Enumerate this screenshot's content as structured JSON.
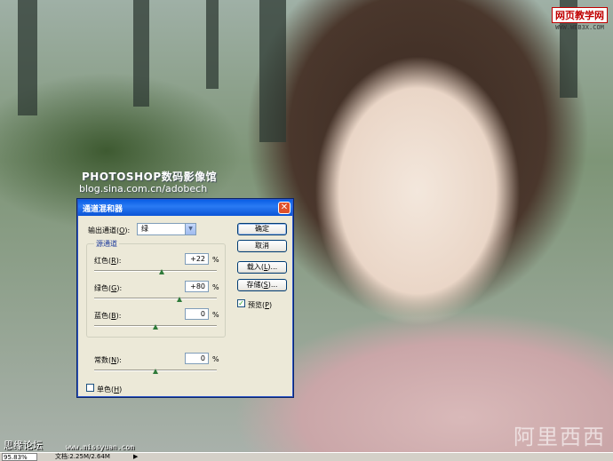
{
  "photo": {
    "caption_line1": "PHOTOSHOP数码影像馆",
    "caption_line2": "blog.sina.com.cn/adobech",
    "watermark_top_line1": "网页教学网",
    "watermark_top_line2": "WWW.WEB3X.COM",
    "watermark_bottom_right": "阿里西西",
    "watermark_bottom_left": "思缘论坛",
    "watermark_bottom_url": "www.missyuan.com"
  },
  "statusbar": {
    "zoom": "95.83%",
    "doc_info": "文档:2.25M/2.64M",
    "arrow": "▶"
  },
  "dialog": {
    "title": "通道混和器",
    "close_glyph": "✕",
    "output_channel_label": "输出通道(",
    "output_channel_key": "O",
    "output_channel_suffix": "):",
    "output_channel_value": "绿",
    "source_group_label": "源通道",
    "red": {
      "label": "红色(",
      "key": "R",
      "suffix": "):",
      "value": "+22",
      "unit": "%",
      "slider_value": 22
    },
    "green": {
      "label": "绿色(",
      "key": "G",
      "suffix": "):",
      "value": "+80",
      "unit": "%",
      "slider_value": 80
    },
    "blue": {
      "label": "蓝色(",
      "key": "B",
      "suffix": "):",
      "value": "0",
      "unit": "%",
      "slider_value": 0
    },
    "constant": {
      "label": "常数(",
      "key": "N",
      "suffix": "):",
      "value": "0",
      "unit": "%",
      "slider_value": 0
    },
    "monochrome": {
      "label": "单色(",
      "key": "H",
      "suffix": ")",
      "checked": false
    },
    "preview": {
      "label": "预览(",
      "key": "P",
      "suffix": ")",
      "checked": true
    },
    "buttons": {
      "ok": "确定",
      "cancel": "取消",
      "load_prefix": "载入(",
      "load_key": "L",
      "load_suffix": ")...",
      "save_prefix": "存储(",
      "save_key": "S",
      "save_suffix": ")..."
    }
  },
  "colors": {
    "title_bar": "#0a5fe5",
    "dialog_bg": "#ece9d8",
    "close_button": "#e0512b",
    "group_label": "#1e3c9c"
  }
}
